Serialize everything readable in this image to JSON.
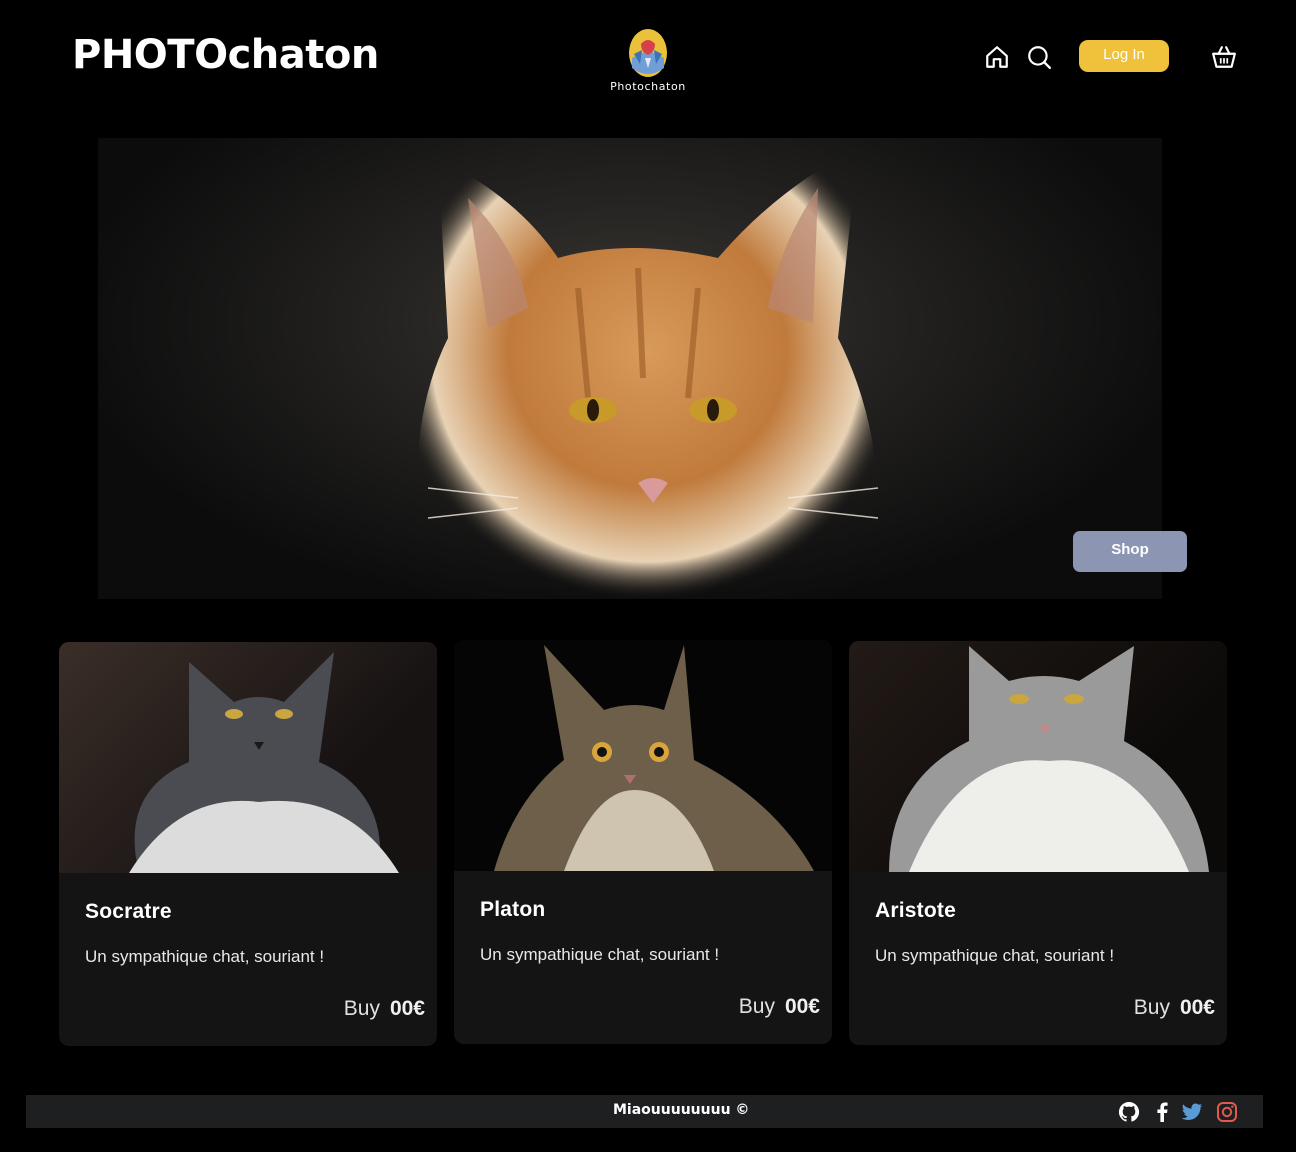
{
  "header": {
    "brand": "PHOTOchaton",
    "logo_text": "Photochaton",
    "icons": [
      "home-icon",
      "search-icon",
      "basket-icon"
    ],
    "login_label": "Log In",
    "login_color": "#f0c23b"
  },
  "hero": {
    "shop_label": "Shop",
    "shop_color": "#8c96b3"
  },
  "products": [
    {
      "name": "Socratre",
      "description": "Un sympathique chat, souriant !",
      "buy_label": "Buy",
      "price": "00€"
    },
    {
      "name": "Platon",
      "description": "Un sympathique chat, souriant !",
      "buy_label": "Buy",
      "price": "00€"
    },
    {
      "name": "Aristote",
      "description": "Un sympathique chat, souriant !",
      "buy_label": "Buy",
      "price": "00€"
    }
  ],
  "footer": {
    "text": "Miaouuuuuuuu ©",
    "social_icons": [
      "github-icon",
      "facebook-icon",
      "twitter-icon",
      "instagram-icon"
    ],
    "twitter_color": "#5b9bd5",
    "instagram_color": "#e05a4f"
  }
}
